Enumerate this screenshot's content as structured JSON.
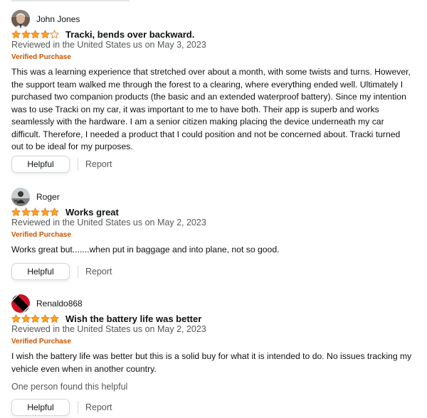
{
  "colors": {
    "star_fill": "#ffa41c",
    "star_stroke": "#de7921",
    "verified": "#c45500",
    "meta_text": "#565959",
    "button_border": "#d5d9d9"
  },
  "reviews": [
    {
      "author": "John Jones",
      "avatar_icon": "user-photo-avatar",
      "rating": 4,
      "rating_max": 5,
      "title": "Tracki, bends over backward.",
      "meta": "Reviewed in the United States us on May 3, 2023",
      "badge": "Verified Purchase",
      "body": "This was a learning experience that stretched over about a month, with some twists and turns. However, the support team walked me through the forest to a clearing, where everything ended well. Ultimately I purchased two companion products (the basic and an extended waterproof battery). Since my intention was to use Tracki on my car, it was important to me to have both. Their app is superb and works seamlessly with the hardware. I am a senior citizen making placing the device underneath my car difficult. Therefore, I needed a product that I could position and not be concerned about. Tracki turned out to be ideal for my purposes.",
      "helpful_label": "Helpful",
      "report_label": "Report"
    },
    {
      "author": "Roger",
      "avatar_icon": "user-photo-avatar",
      "rating": 5,
      "rating_max": 5,
      "title": "Works great",
      "meta": "Reviewed in the United States us on May 2, 2023",
      "badge": "Verified Purchase",
      "body": "Works great but.......when put in baggage and into plane, not so good.",
      "helpful_label": "Helpful",
      "report_label": "Report"
    },
    {
      "author": "Renaldo868",
      "avatar_icon": "flag-avatar",
      "rating": 5,
      "rating_max": 5,
      "title": "Wish the battery life was better",
      "meta": "Reviewed in the United States us on May 2, 2023",
      "badge": "Verified Purchase",
      "body": "I wish the battery life was better but this is a solid buy for what it is intended to do. No issues tracking my vehicle even when in another country.",
      "found_helpful": "One person found this helpful",
      "helpful_label": "Helpful",
      "report_label": "Report"
    }
  ]
}
